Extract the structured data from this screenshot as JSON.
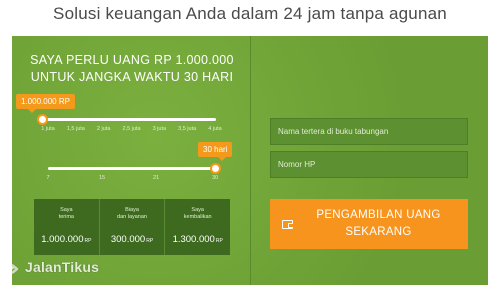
{
  "headline": "Solusi keuangan Anda dalam 24 jam tanpa agunan",
  "calculator": {
    "amount_line1": "SAYA PERLU UANG RP 1.000.000",
    "amount_line2": "UNTUK JANGKA WAKTU 30 HARI",
    "amount_slider": {
      "tooltip": "1.000.000 RP",
      "selected_fraction": 0.0,
      "ticks": [
        "1 juta",
        "1,5 juta",
        "2 juta",
        "2,5 juta",
        "3 juta",
        "3,5 juta",
        "4 juta"
      ]
    },
    "days_slider": {
      "tooltip": "30 hari",
      "selected_fraction": 1.0,
      "ticks": [
        "7",
        "15",
        "21",
        "30"
      ]
    },
    "summary": [
      {
        "label": "Saya\nterima",
        "value": "1.000.000",
        "unit": "RP"
      },
      {
        "label": "Biaya\ndan layanan",
        "value": "300.000",
        "unit": "RP"
      },
      {
        "label": "Saya\nkembalikan",
        "value": "1.300.000",
        "unit": "RP"
      }
    ]
  },
  "form": {
    "name_placeholder": "Nama tertera di buku tabungan",
    "phone_placeholder": "Nomor HP",
    "submit_label": "PENGAMBILAN UANG\nSEKARANG"
  },
  "watermark": {
    "text": "JalanTikus"
  },
  "colors": {
    "panel_green": "#6fa436",
    "accent_orange": "#f7941d",
    "summary_dark_green": "#3d6a1f"
  }
}
